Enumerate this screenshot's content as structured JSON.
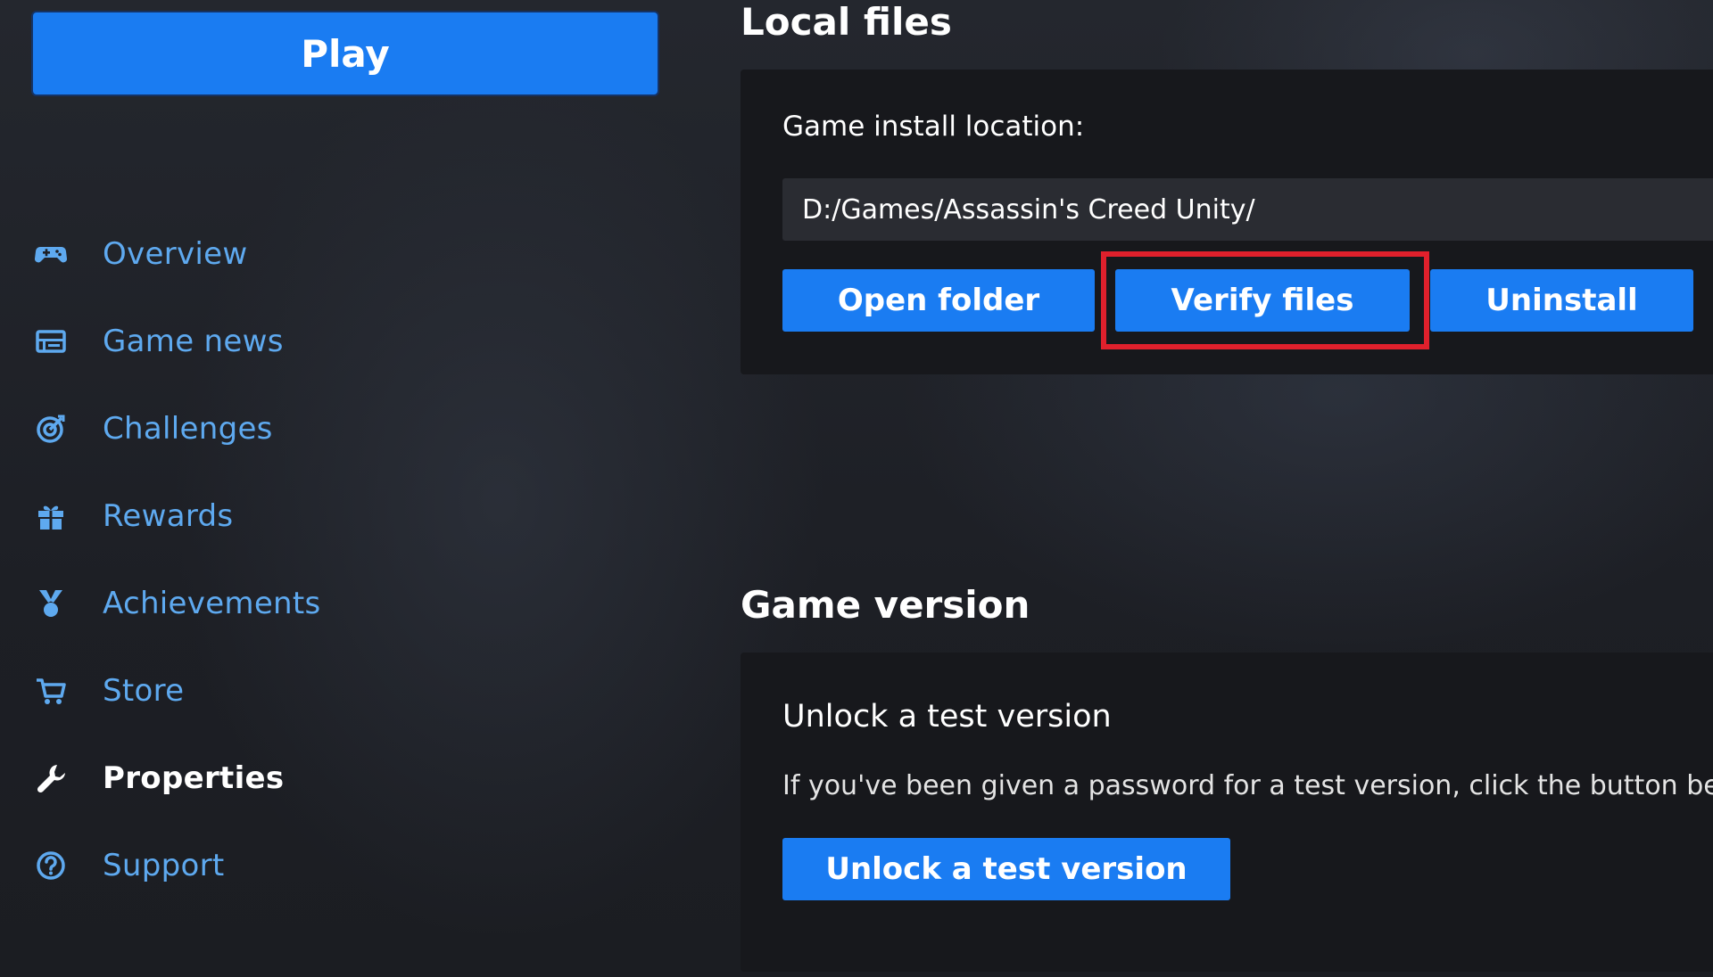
{
  "play_button": {
    "label": "Play"
  },
  "nav": {
    "items": [
      {
        "label": "Overview",
        "icon": "gamepad-icon",
        "active": false
      },
      {
        "label": "Game news",
        "icon": "news-icon",
        "active": false
      },
      {
        "label": "Challenges",
        "icon": "target-icon",
        "active": false
      },
      {
        "label": "Rewards",
        "icon": "gift-icon",
        "active": false
      },
      {
        "label": "Achievements",
        "icon": "medal-icon",
        "active": false
      },
      {
        "label": "Store",
        "icon": "cart-icon",
        "active": false
      },
      {
        "label": "Properties",
        "icon": "wrench-icon",
        "active": true
      },
      {
        "label": "Support",
        "icon": "help-icon",
        "active": false
      }
    ]
  },
  "local_files": {
    "title": "Local files",
    "install_label": "Game install location:",
    "install_path": "D:/Games/Assassin's Creed Unity/",
    "buttons": {
      "open_folder": "Open folder",
      "verify_files": "Verify files",
      "uninstall": "Uninstall"
    }
  },
  "game_version": {
    "title": "Game version",
    "subtitle": "Unlock a test version",
    "description": "If you've been given a password for a test version, click the button below",
    "button": "Unlock a test version"
  },
  "colors": {
    "accent": "#1a7cf2",
    "nav_text": "#5ea9ef",
    "highlight": "#e0202c",
    "panel": "#17181c",
    "background": "#1e2026"
  }
}
